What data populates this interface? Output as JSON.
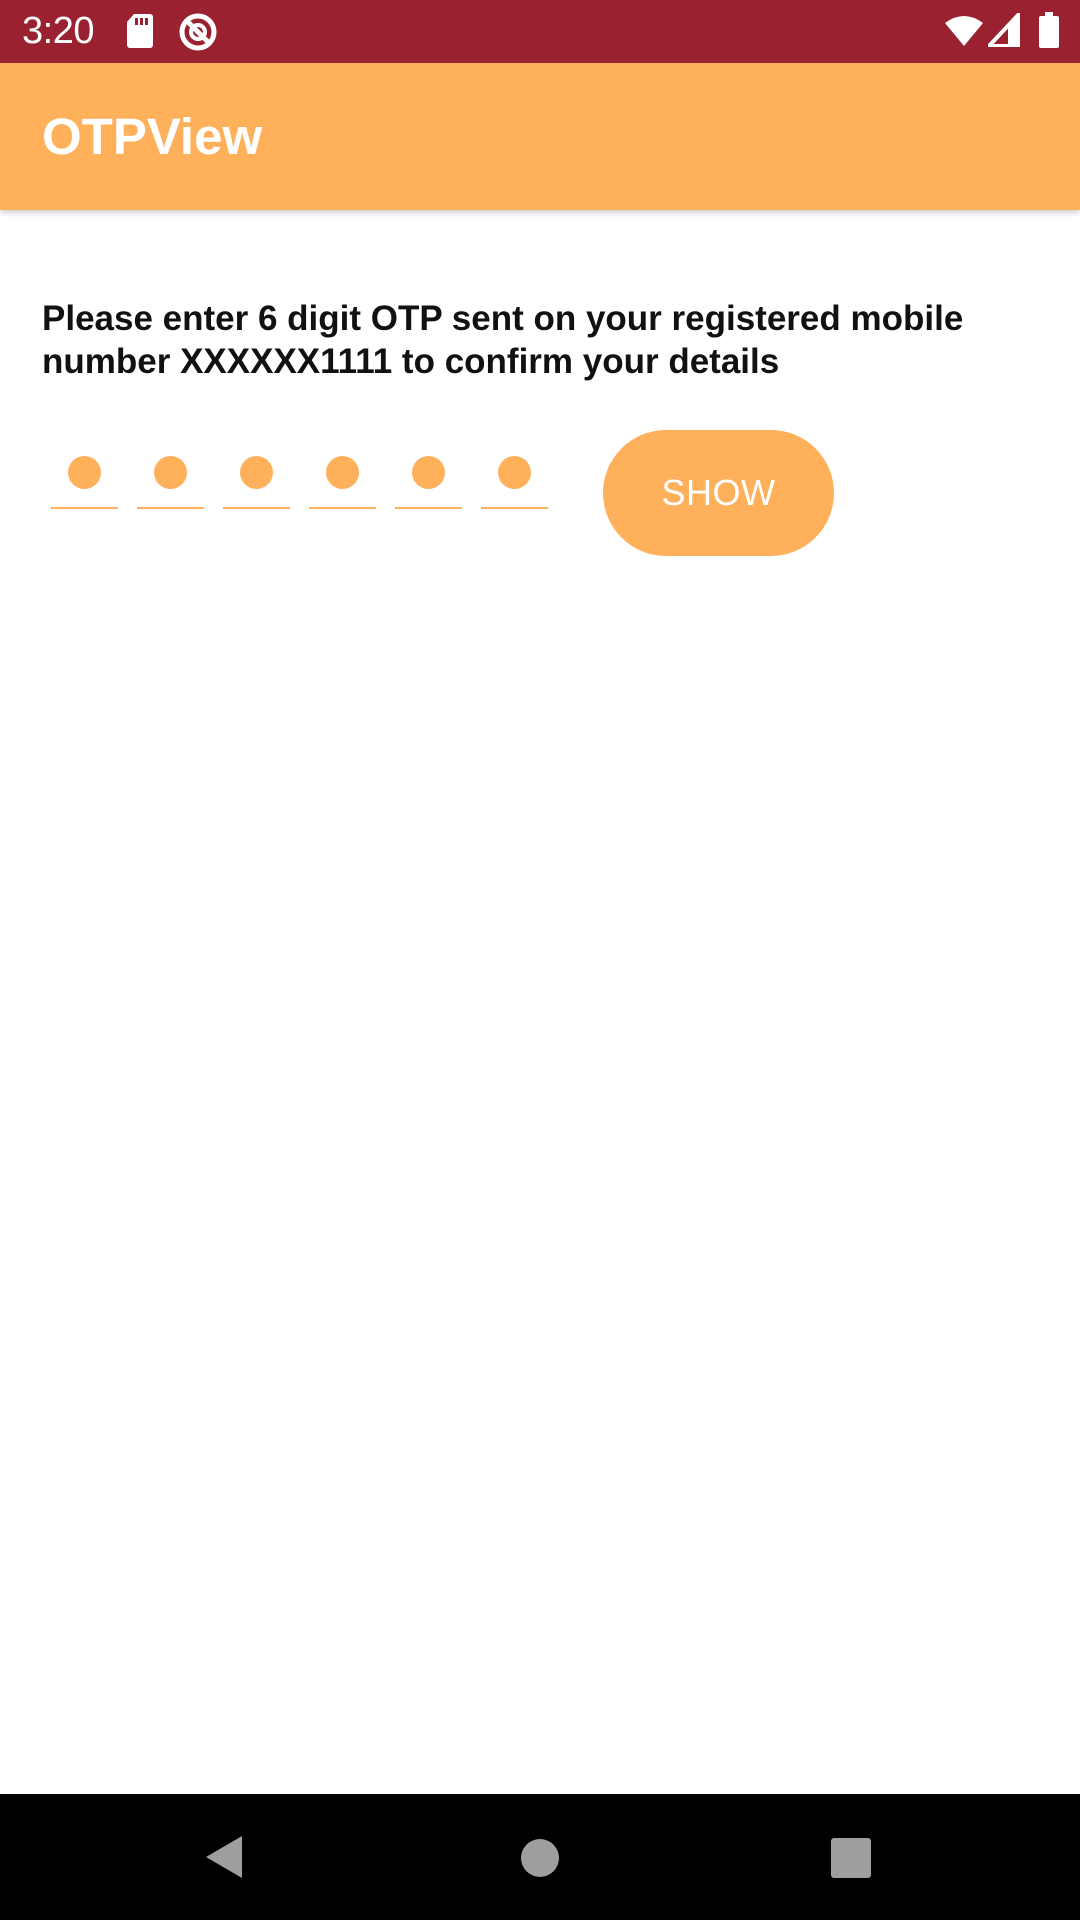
{
  "status_bar": {
    "time": "3:20",
    "icons": [
      "sd-card-icon",
      "no-disturb-icon",
      "wifi-icon",
      "signal-icon",
      "battery-icon"
    ],
    "background": "#9a2230"
  },
  "app_bar": {
    "title": "OTPView",
    "background": "#ffb05a"
  },
  "main": {
    "instruction": "Please enter 6 digit OTP sent on your registered mobile number XXXXXX1111 to confirm your details",
    "otp_length": 6,
    "otp_filled": 6,
    "accent": "#ffb05a",
    "show_button_label": "SHOW"
  },
  "nav_bar": {
    "buttons": [
      "back-icon",
      "home-icon",
      "recents-icon"
    ]
  }
}
